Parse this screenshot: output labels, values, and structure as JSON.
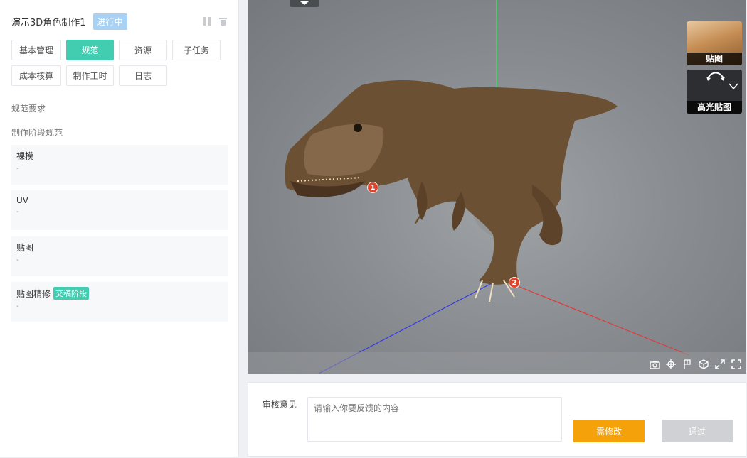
{
  "task": {
    "title": "演示3D角色制作1",
    "status": "进行中"
  },
  "tabs": [
    {
      "label": "基本管理",
      "active": false
    },
    {
      "label": "规范",
      "active": true
    },
    {
      "label": "资源",
      "active": false
    },
    {
      "label": "子任务",
      "active": false
    },
    {
      "label": "成本核算",
      "active": false
    },
    {
      "label": "制作工时",
      "active": false
    },
    {
      "label": "日志",
      "active": false
    }
  ],
  "spec": {
    "requirements_label": "规范要求",
    "stage_spec_label": "制作阶段规范",
    "stages": [
      {
        "name": "裸模",
        "detail": "-"
      },
      {
        "name": "UV",
        "detail": "-"
      },
      {
        "name": "贴图",
        "detail": "-"
      },
      {
        "name": "贴图精修",
        "detail": "-",
        "tag": "交稿阶段"
      }
    ]
  },
  "viewport": {
    "texture_thumbs": [
      {
        "label": "贴图"
      },
      {
        "label": "高光贴图"
      }
    ],
    "markers": [
      "1",
      "2"
    ],
    "toolbar_icons": [
      "camera-icon",
      "move-icon",
      "flag-icon",
      "cube-icon",
      "expand-icon",
      "fullscreen-icon"
    ]
  },
  "review": {
    "label": "审核意见",
    "placeholder": "请输入你要反馈的内容",
    "revise_button": "需修改",
    "pass_button": "通过"
  },
  "colors": {
    "accent_green": "#42ccb0",
    "status_blue": "#a8d1f4",
    "revise_orange": "#f5a20a",
    "pass_disabled": "#cfd1d4"
  }
}
